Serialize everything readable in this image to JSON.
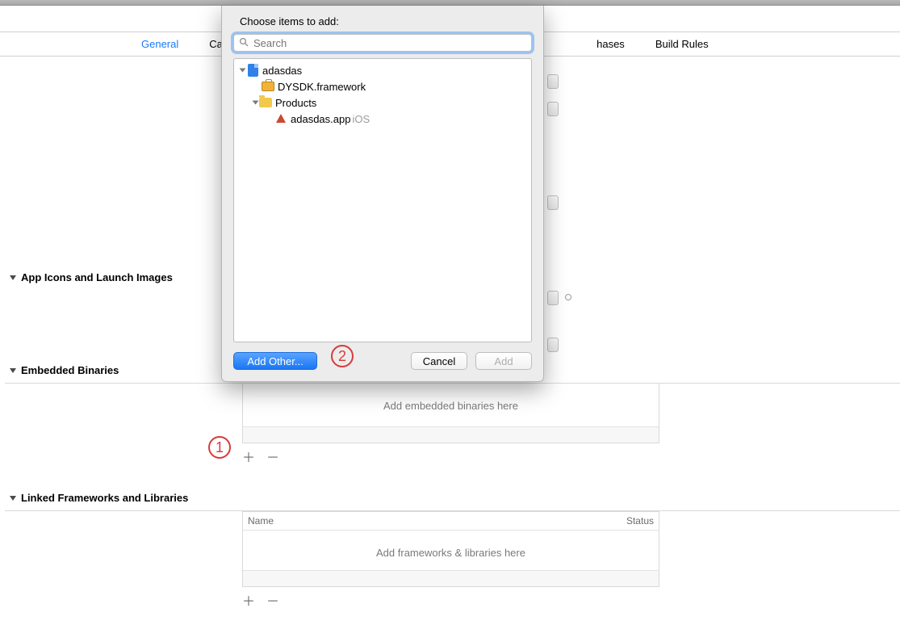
{
  "tabs": {
    "general": "General",
    "capabilities": "Cap",
    "build_phases_suffix": "hases",
    "build_rules": "Build Rules"
  },
  "sections": {
    "app_icons": "App Icons and Launch Images",
    "embedded": "Embedded Binaries",
    "linked": "Linked Frameworks and Libraries"
  },
  "embedded_placeholder": "Add embedded binaries here",
  "linked_placeholder": "Add frameworks & libraries here",
  "col_name": "Name",
  "col_status": "Status",
  "sheet": {
    "title": "Choose items to add:",
    "search_placeholder": "Search",
    "tree": {
      "root": "adasdas",
      "framework": "DYSDK.framework",
      "products": "Products",
      "app": "adasdas.app",
      "app_platform": "iOS"
    },
    "add_other": "Add Other...",
    "cancel": "Cancel",
    "add": "Add"
  },
  "annotations": {
    "one": "1",
    "two": "2"
  }
}
